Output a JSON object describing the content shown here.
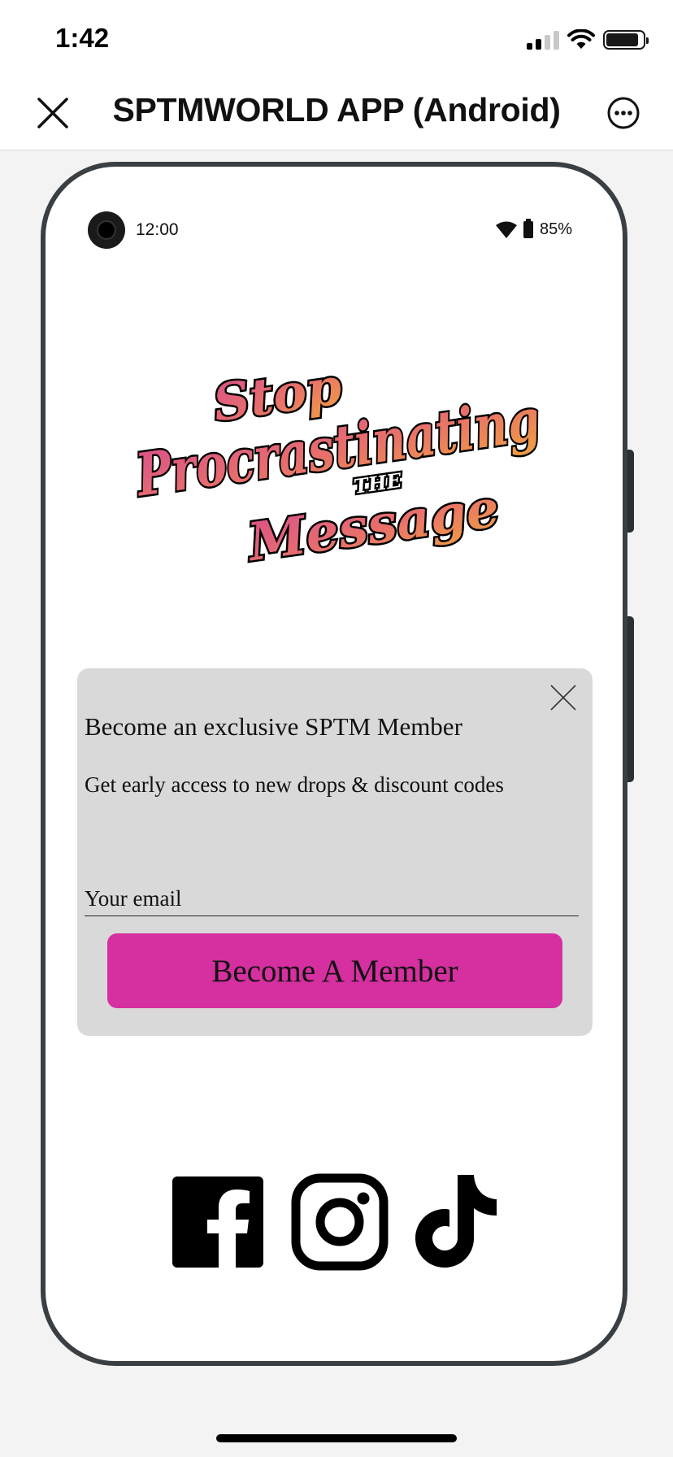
{
  "ios_status": {
    "time": "1:42"
  },
  "navbar": {
    "title": "SPTMWORLD APP (Android)"
  },
  "android_status": {
    "time": "12:00",
    "battery": "85%"
  },
  "logo": {
    "line1": "Stop",
    "line2": "Procrastinating",
    "line3": "THE",
    "line4": "Message"
  },
  "popup": {
    "title": "Become an exclusive SPTM Member",
    "subtitle": "Get early access to new drops & discount codes",
    "email_placeholder": "Your email",
    "button_label": "Become A Member"
  },
  "colors": {
    "accent_button": "#d52fa0",
    "popup_bg": "#d9d9d9",
    "phone_frame": "#3a3f44",
    "page_bg": "#f3f3f3"
  },
  "icons": [
    "close-icon",
    "more-icon",
    "wifi-icon",
    "battery-icon",
    "facebook-icon",
    "instagram-icon",
    "tiktok-icon"
  ]
}
